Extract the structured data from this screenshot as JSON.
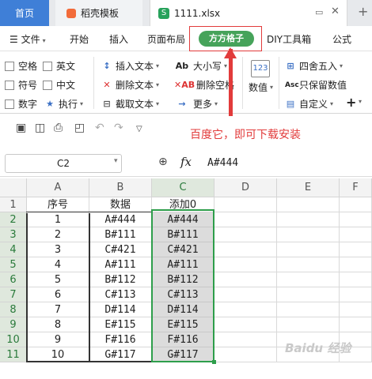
{
  "tabs": {
    "home": "首页",
    "daoke": "稻壳模板",
    "file": "1111.xlsx"
  },
  "menu": {
    "file": "文件",
    "items": [
      "开始",
      "插入",
      "页面布局",
      "方方格子",
      "DIY工具箱",
      "公式"
    ]
  },
  "ribbon": {
    "checks": [
      "空格",
      "英文",
      "符号",
      "中文",
      "数字"
    ],
    "execute": "执行",
    "col2": [
      "插入文本",
      "删除文本",
      "截取文本"
    ],
    "col3": [
      "大小写",
      "删除空格",
      "更多"
    ],
    "numeric": "数值",
    "col5": [
      "四舍五入",
      "只保留数值",
      "自定义"
    ]
  },
  "annotation": "百度它，即可下载安装",
  "formula": {
    "namebox": "C2",
    "fx": "fx",
    "value": "A#444"
  },
  "columns": [
    "A",
    "B",
    "C",
    "D",
    "E",
    "F"
  ],
  "rows": [
    "1",
    "2",
    "3",
    "4",
    "5",
    "6",
    "7",
    "8",
    "9",
    "10",
    "11"
  ],
  "table": {
    "headers": [
      "序号",
      "数据",
      "添加0"
    ],
    "data": [
      [
        "1",
        "A#444",
        "A#444"
      ],
      [
        "2",
        "B#111",
        "B#111"
      ],
      [
        "3",
        "C#421",
        "C#421"
      ],
      [
        "4",
        "A#111",
        "A#111"
      ],
      [
        "5",
        "B#112",
        "B#112"
      ],
      [
        "6",
        "C#113",
        "C#113"
      ],
      [
        "7",
        "D#114",
        "D#114"
      ],
      [
        "8",
        "E#115",
        "E#115"
      ],
      [
        "9",
        "F#116",
        "F#116"
      ],
      [
        "10",
        "G#117",
        "G#117"
      ]
    ]
  },
  "watermark": "Baidu 经验",
  "colors": {
    "accent": "#46a35a",
    "selection": "#2e9e4b",
    "annotation": "#e23b3b",
    "home_tab": "#3f7fd7"
  }
}
